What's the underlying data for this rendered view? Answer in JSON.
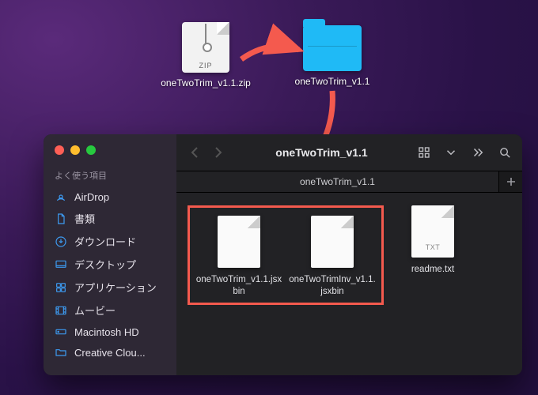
{
  "desktop": {
    "zip": {
      "label": "oneTwoTrim_v1.1.zip",
      "badge": "ZIP"
    },
    "folder": {
      "label": "oneTwoTrim_v1.1"
    }
  },
  "finder": {
    "title": "oneTwoTrim_v1.1",
    "tab": "oneTwoTrim_v1.1",
    "sidebar": {
      "header": "よく使う項目",
      "items": [
        {
          "icon": "airdrop",
          "label": "AirDrop"
        },
        {
          "icon": "doc",
          "label": "書類"
        },
        {
          "icon": "download",
          "label": "ダウンロード"
        },
        {
          "icon": "desktop",
          "label": "デスクトップ"
        },
        {
          "icon": "apps",
          "label": "アプリケーション"
        },
        {
          "icon": "movie",
          "label": "ムービー"
        },
        {
          "icon": "hd",
          "label": "Macintosh HD"
        },
        {
          "icon": "cloud",
          "label": "Creative Clou..."
        }
      ]
    },
    "files": [
      {
        "name": "oneTwoTrim_v1.1.jsxbin",
        "ext": ""
      },
      {
        "name": "oneTwoTrimInv_v1.1.jsxbin",
        "ext": ""
      },
      {
        "name": "readme.txt",
        "ext": "TXT"
      }
    ]
  },
  "highlight_count": 2
}
